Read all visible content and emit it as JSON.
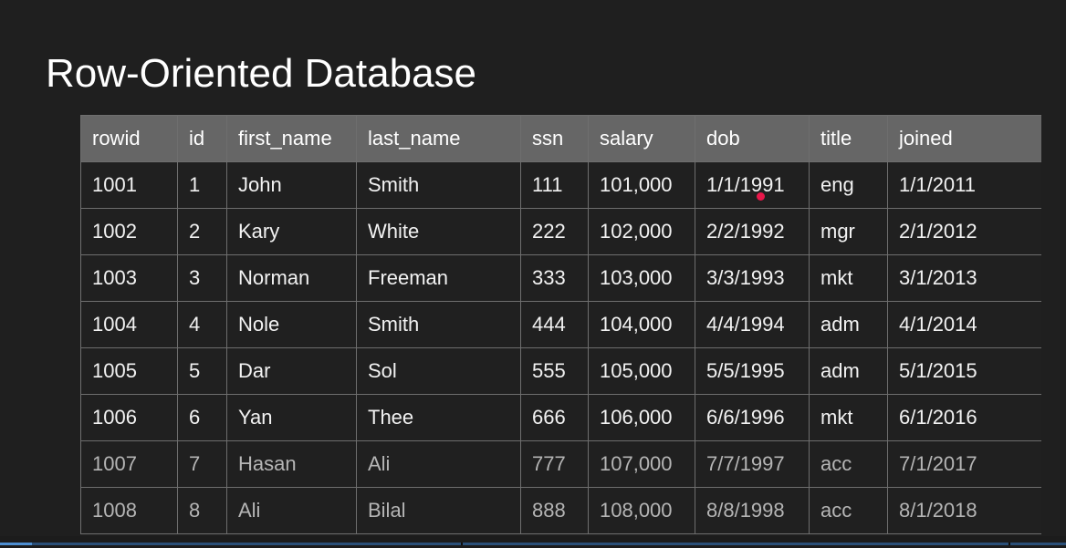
{
  "slide": {
    "title": "Row-Oriented Database"
  },
  "table": {
    "columns": [
      "rowid",
      "id",
      "first_name",
      "last_name",
      "ssn",
      "salary",
      "dob",
      "title",
      "joined"
    ],
    "rows": [
      [
        "1001",
        "1",
        "John",
        "Smith",
        "111",
        "101,000",
        "1/1/1991",
        "eng",
        "1/1/2011"
      ],
      [
        "1002",
        "2",
        "Kary",
        "White",
        "222",
        "102,000",
        "2/2/1992",
        "mgr",
        "2/1/2012"
      ],
      [
        "1003",
        "3",
        "Norman",
        "Freeman",
        "333",
        "103,000",
        "3/3/1993",
        "mkt",
        "3/1/2013"
      ],
      [
        "1004",
        "4",
        "Nole",
        "Smith",
        "444",
        "104,000",
        "4/4/1994",
        "adm",
        "4/1/2014"
      ],
      [
        "1005",
        "5",
        "Dar",
        "Sol",
        "555",
        "105,000",
        "5/5/1995",
        "adm",
        "5/1/2015"
      ],
      [
        "1006",
        "6",
        "Yan",
        "Thee",
        "666",
        "106,000",
        "6/6/1996",
        "mkt",
        "6/1/2016"
      ],
      [
        "1007",
        "7",
        "Hasan",
        "Ali",
        "777",
        "107,000",
        "7/7/1997",
        "acc",
        "7/1/2017"
      ],
      [
        "1008",
        "8",
        "Ali",
        "Bilal",
        "888",
        "108,000",
        "8/8/1998",
        "acc",
        "8/1/2018"
      ]
    ]
  },
  "video_progress": {
    "played_fraction": 0.03
  },
  "colors": {
    "background": "#1f1f1f",
    "header_fill": "#666666",
    "grid_line": "#6e6e6e",
    "laser_pointer": "#e8174a",
    "progress_played": "#4d8ed1"
  }
}
